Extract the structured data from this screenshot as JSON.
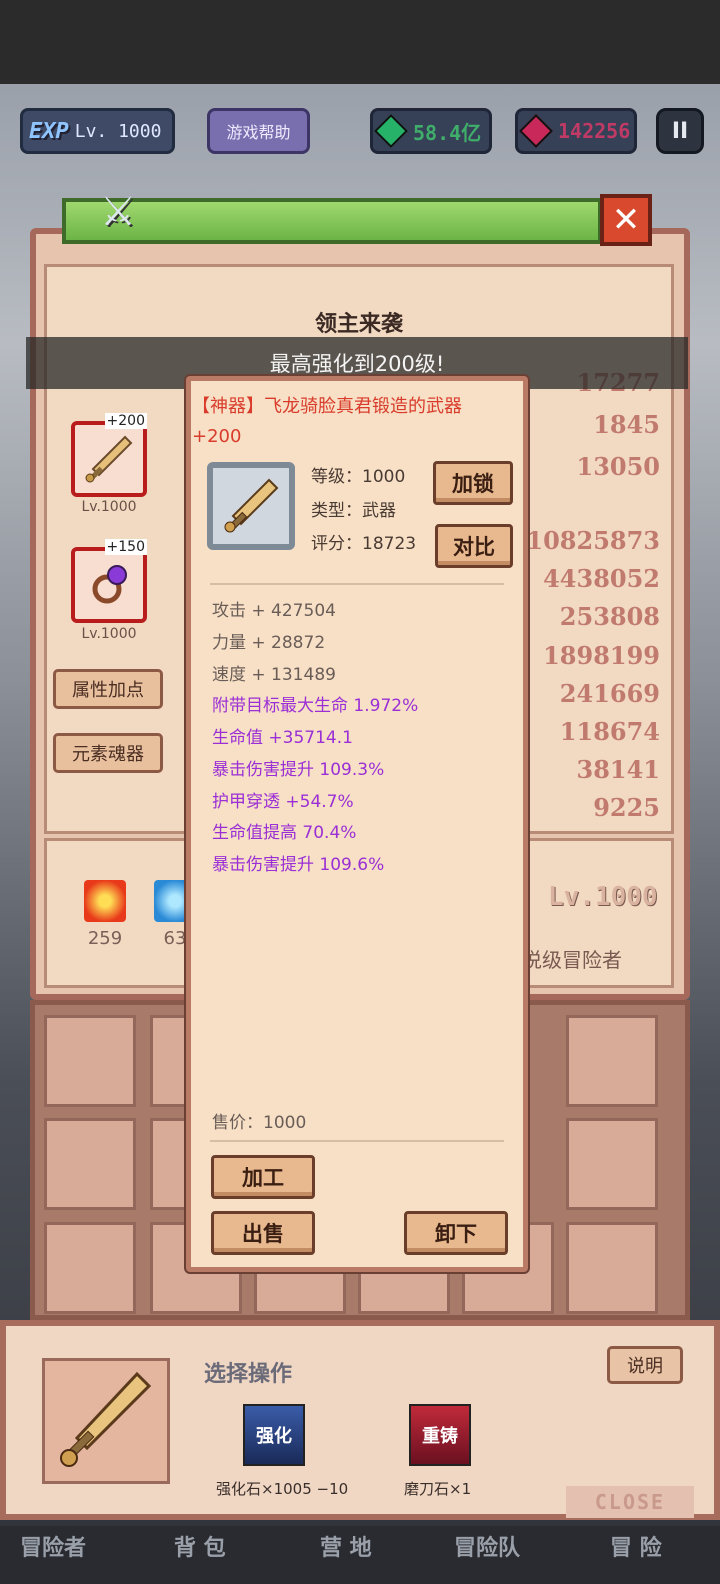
{
  "hud": {
    "exp_logo": "EXP",
    "level": "Lv. 1000",
    "help": "游戏帮助",
    "gold": "58.4亿",
    "gems": "142256",
    "pause": "II"
  },
  "window": {
    "panel_title": "领主来袭",
    "notice": "最高强化到200级!",
    "close": "✕"
  },
  "equip_slots": [
    {
      "plus": "+200",
      "lv": "Lv.1000"
    },
    {
      "plus": "+150",
      "lv": "Lv.1000"
    }
  ],
  "side_buttons": [
    "属性加点",
    "元素魂器"
  ],
  "stats": [
    "17277",
    "1845",
    "13050",
    "10825873",
    "4438052",
    "253808",
    "1898199",
    "241669",
    "118674",
    "38141",
    "9225"
  ],
  "resources": [
    "259",
    "63"
  ],
  "hero": {
    "level": "Lv.1000",
    "title": "说级冒险者"
  },
  "popup": {
    "name_line1": "【神器】飞龙骑脸真君锻造的武器",
    "name_line2": "+200",
    "level": "等级：1000",
    "type": "类型：武器",
    "score": "评分：18723",
    "lock_button": "加锁",
    "compare_button": "对比",
    "base_attrs": [
      "攻击 + 427504",
      "力量 + 28872",
      "速度 + 131489"
    ],
    "bonus_attrs": [
      "附带目标最大生命 1.972%",
      "生命值 +35714.1",
      "暴击伤害提升 109.3%",
      "护甲穿透 +54.7%",
      "生命值提高 70.4%",
      "暴击伤害提升 109.6%"
    ],
    "price": "售价：1000",
    "process_button": "加工",
    "sell_button": "出售",
    "unequip_button": "卸下"
  },
  "bottom": {
    "choose": "选择操作",
    "explain": "说明",
    "op1_icon": "强化",
    "op1_label": "强化石×1005 −10",
    "op2_icon": "重铸",
    "op2_label": "磨刀石×1",
    "close": "CLOSE"
  },
  "tabs": [
    "冒险者",
    "背 包",
    "营 地",
    "冒险队",
    "冒 险"
  ],
  "colors": {
    "accent_red": "#d93c2c",
    "bonus_purple": "#9b2fd6",
    "panel": "#f7e0c5"
  }
}
